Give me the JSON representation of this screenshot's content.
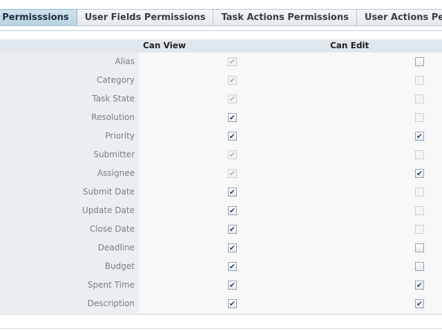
{
  "tabs": [
    {
      "label": "s Permisssions",
      "active": true
    },
    {
      "label": "User Fields Permissions",
      "active": false
    },
    {
      "label": "Task Actions Permissions",
      "active": false
    },
    {
      "label": "User Actions Permissio",
      "active": false
    }
  ],
  "table": {
    "col_view": "Can View",
    "col_edit": "Can Edit",
    "rows": [
      {
        "label": "Alias",
        "view": true,
        "view_disabled": true,
        "edit": false,
        "edit_disabled": false
      },
      {
        "label": "Category",
        "view": true,
        "view_disabled": true,
        "edit": false,
        "edit_disabled": true
      },
      {
        "label": "Task State",
        "view": true,
        "view_disabled": true,
        "edit": false,
        "edit_disabled": true
      },
      {
        "label": "Resolution",
        "view": true,
        "view_disabled": false,
        "edit": false,
        "edit_disabled": true
      },
      {
        "label": "Priority",
        "view": true,
        "view_disabled": false,
        "edit": true,
        "edit_disabled": false
      },
      {
        "label": "Submitter",
        "view": true,
        "view_disabled": true,
        "edit": false,
        "edit_disabled": true
      },
      {
        "label": "Assignee",
        "view": true,
        "view_disabled": true,
        "edit": true,
        "edit_disabled": false
      },
      {
        "label": "Submit Date",
        "view": true,
        "view_disabled": false,
        "edit": false,
        "edit_disabled": true
      },
      {
        "label": "Update Date",
        "view": true,
        "view_disabled": false,
        "edit": false,
        "edit_disabled": true
      },
      {
        "label": "Close Date",
        "view": true,
        "view_disabled": false,
        "edit": false,
        "edit_disabled": true
      },
      {
        "label": "Deadline",
        "view": true,
        "view_disabled": false,
        "edit": false,
        "edit_disabled": false
      },
      {
        "label": "Budget",
        "view": true,
        "view_disabled": false,
        "edit": false,
        "edit_disabled": false
      },
      {
        "label": "Spent Time",
        "view": true,
        "view_disabled": false,
        "edit": true,
        "edit_disabled": false
      },
      {
        "label": "Description",
        "view": true,
        "view_disabled": false,
        "edit": true,
        "edit_disabled": false
      }
    ]
  },
  "colors": {
    "active_tab": "#b9d2e3",
    "label_cell": "#e9eef2",
    "header_row": "#dfe6ec",
    "checkmark": "#2a4670"
  },
  "icons": {
    "check": "checkmark-icon"
  }
}
